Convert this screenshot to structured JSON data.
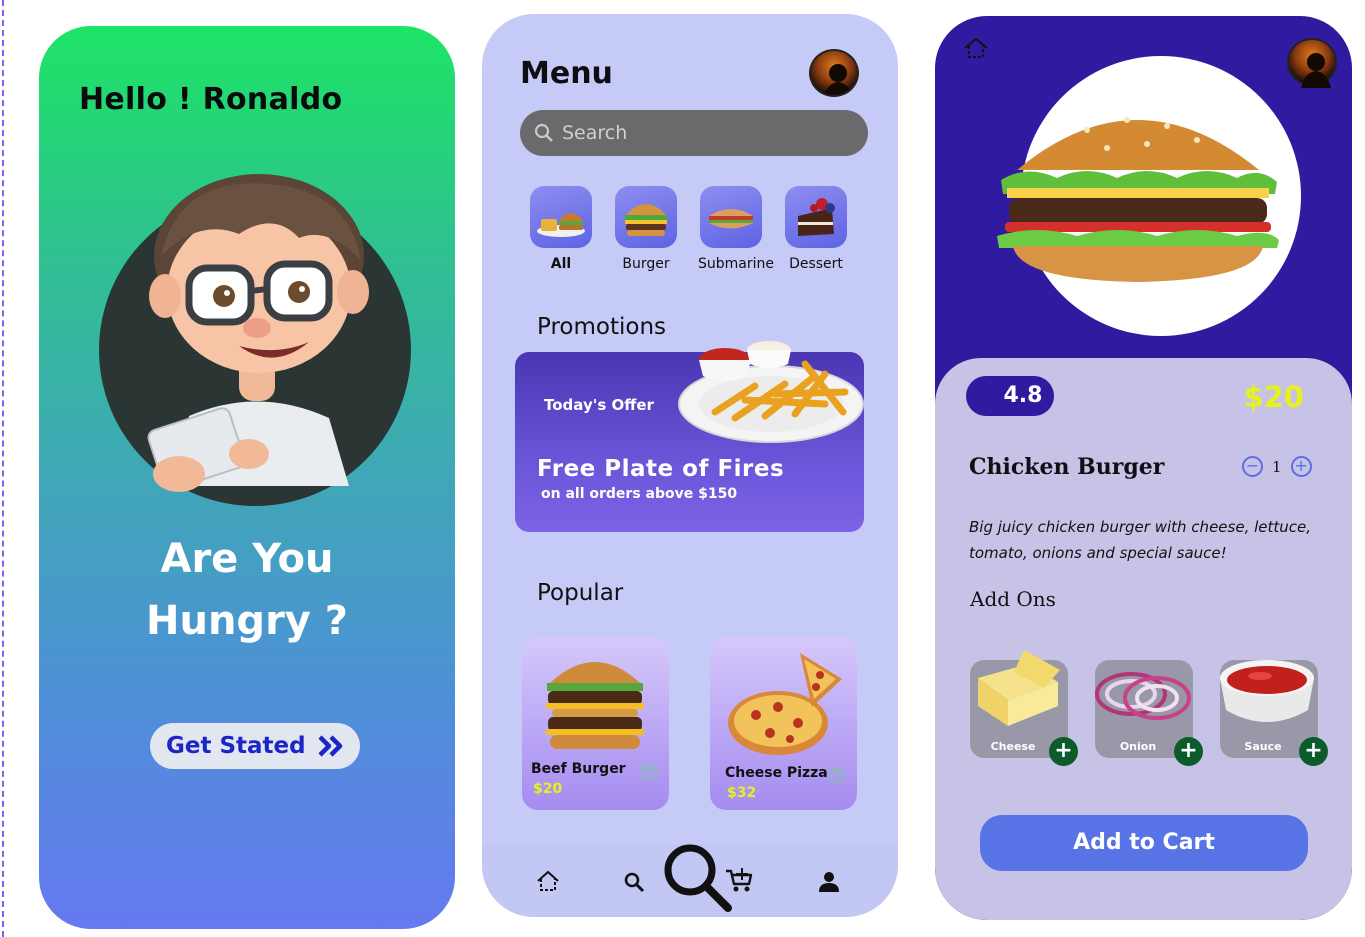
{
  "welcome": {
    "greeting": "Hello ! Ronaldo",
    "headline_line1": "Are You",
    "headline_line2": "Hungry ?",
    "cta_label": "Get Stated",
    "gradient": [
      "#1de465",
      "#6679f1"
    ]
  },
  "menu": {
    "title": "Menu",
    "search_placeholder": "Search",
    "categories": [
      {
        "label": "All",
        "icon": "mixed-food-icon",
        "selected": true
      },
      {
        "label": "Burger",
        "icon": "burger-icon",
        "selected": false
      },
      {
        "label": "Submarine",
        "icon": "submarine-icon",
        "selected": false
      },
      {
        "label": "Dessert",
        "icon": "cake-icon",
        "selected": false
      }
    ],
    "promotions_title": "Promotions",
    "promo": {
      "tag": "Today's Offer",
      "headline": "Free Plate of Fires",
      "subtext": "on all orders above $150"
    },
    "popular_title": "Popular",
    "popular": [
      {
        "name": "Beef Burger",
        "price": "$20"
      },
      {
        "name": "Cheese Pizza",
        "price": "$32"
      }
    ],
    "nav": [
      "home-icon",
      "search-icon",
      "cart-icon",
      "profile-icon"
    ],
    "accent": "#c6caf6"
  },
  "detail": {
    "rating": "4.8",
    "price": "$20",
    "title": "Chicken Burger",
    "quantity": "1",
    "description": "Big juicy chicken burger with cheese, lettuce, tomato, onions and special sauce!",
    "addons_title": "Add Ons",
    "addons": [
      {
        "label": "Cheese"
      },
      {
        "label": "Onion"
      },
      {
        "label": "Sauce"
      }
    ],
    "cta_label": "Add to Cart",
    "brand_color": "#2f1aa0",
    "price_color": "#e8f21a"
  }
}
